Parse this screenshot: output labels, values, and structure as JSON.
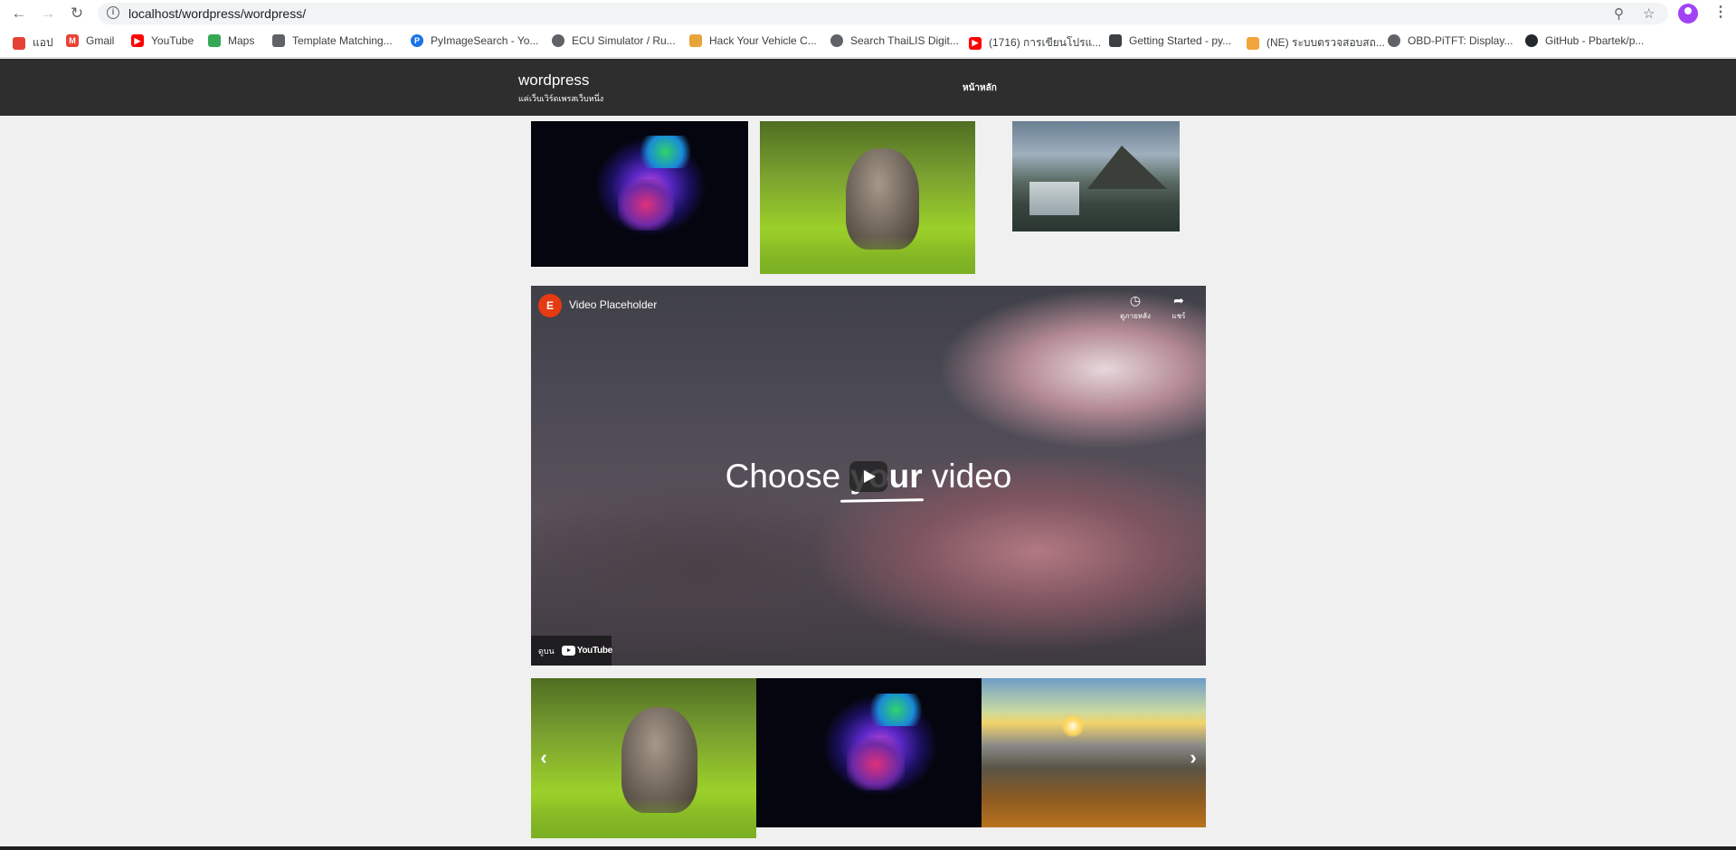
{
  "browser": {
    "url": "localhost/wordpress/wordpress/",
    "nav": {
      "back": "←",
      "forward": "→",
      "reload": "↻"
    },
    "icons": {
      "info": "info-icon",
      "zoom": "zoom-icon",
      "star": "star-icon",
      "menu": "menu-icon"
    }
  },
  "bookmarks": [
    {
      "label": "แอป",
      "icon": "apps-icon",
      "color": "#ea4335"
    },
    {
      "label": "Gmail",
      "icon": "gmail-icon",
      "color": "#ea4335"
    },
    {
      "label": "YouTube",
      "icon": "youtube-icon",
      "color": "#ff0000"
    },
    {
      "label": "Maps",
      "icon": "maps-icon",
      "color": "#34a853"
    },
    {
      "label": "Template Matching...",
      "icon": "page-icon",
      "color": "#5f6368"
    },
    {
      "label": "PyImageSearch - Yo...",
      "icon": "pyimagesearch-icon",
      "color": "#1a73e8"
    },
    {
      "label": "ECU Simulator / Ru...",
      "icon": "globe-icon",
      "color": "#5f6368"
    },
    {
      "label": "Hack Your Vehicle C...",
      "icon": "hack-icon",
      "color": "#e8a33a"
    },
    {
      "label": "Search ThaiLIS Digit...",
      "icon": "globe-icon",
      "color": "#5f6368"
    },
    {
      "label": "(1716) การเขียนโปรแ...",
      "icon": "youtube-icon",
      "color": "#ff0000"
    },
    {
      "label": "Getting Started - py...",
      "icon": "book-icon",
      "color": "#3c4043"
    },
    {
      "label": "(NE) ระบบตรวจสอบสถ...",
      "icon": "ne-icon",
      "color": "#f2a53a"
    },
    {
      "label": "OBD-PiTFT: Display...",
      "icon": "globe-icon",
      "color": "#5f6368"
    },
    {
      "label": "GitHub - Pbartek/p...",
      "icon": "github-icon",
      "color": "#24292e"
    }
  ],
  "site": {
    "title": "wordpress",
    "tagline": "แค่เว็บเวิร์ดเพรสเว็บหนึ่ง",
    "nav_home": "หน้าหลัก"
  },
  "gallery": [
    {
      "name": "gallery-image-neon-face",
      "subject": "neon face portrait"
    },
    {
      "name": "gallery-image-kitten",
      "subject": "kitten in grass"
    },
    {
      "name": "gallery-image-waterfall-mountain",
      "subject": "waterfall and mountain"
    }
  ],
  "video": {
    "title": "Video Placeholder",
    "logo_glyph": "E",
    "headline_before": "Choose ",
    "headline_bold": "your",
    "headline_after": " video",
    "watch_later_label": "ดูภายหลัง",
    "share_label": "แชร์",
    "watch_on_label": "ดูบน",
    "youtube_label": "YouTube"
  },
  "carousel": {
    "slides": [
      {
        "name": "carousel-slide-kitten",
        "subject": "kitten in grass"
      },
      {
        "name": "carousel-slide-neon-face",
        "subject": "neon face portrait"
      },
      {
        "name": "carousel-slide-sunset-hills",
        "subject": "sunset over hills"
      }
    ],
    "prev_glyph": "‹",
    "next_glyph": "›"
  }
}
